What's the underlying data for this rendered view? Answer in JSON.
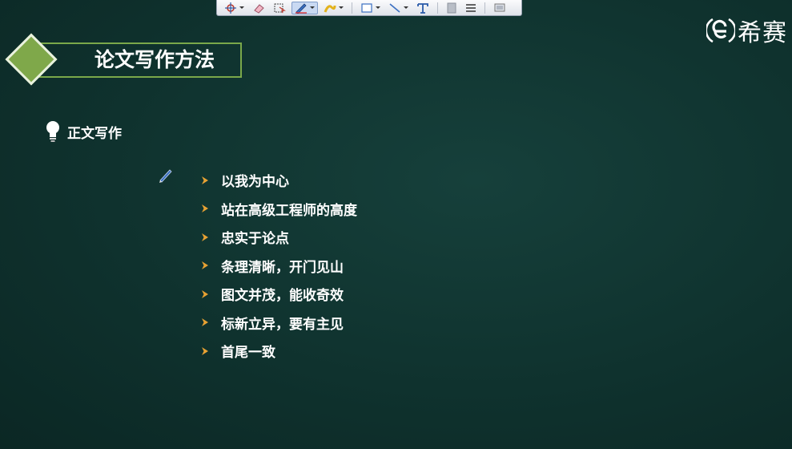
{
  "toolbar": {
    "tools": [
      "pointer-icon",
      "eraser-icon",
      "select-icon",
      "pen-icon",
      "highlighter-icon",
      "rectangle-icon",
      "line-icon",
      "text-icon",
      "gray-box-icon",
      "menu-lines-icon",
      "screen-icon"
    ],
    "active_tool": "pen-icon"
  },
  "logo": {
    "text": "希赛"
  },
  "slide": {
    "title": "论文写作方法",
    "section": "正文写作",
    "items": [
      "以我为中心",
      "站在高级工程师的高度",
      "忠实于论点",
      "条理清晰，开门见山",
      "图文并茂，能收奇效",
      "标新立异，要有主见",
      "首尾一致"
    ]
  },
  "colors": {
    "background": "#0f322e",
    "accent_green": "#7fa84a",
    "bullet_orange": "#e8a233",
    "text": "#ffffff"
  }
}
